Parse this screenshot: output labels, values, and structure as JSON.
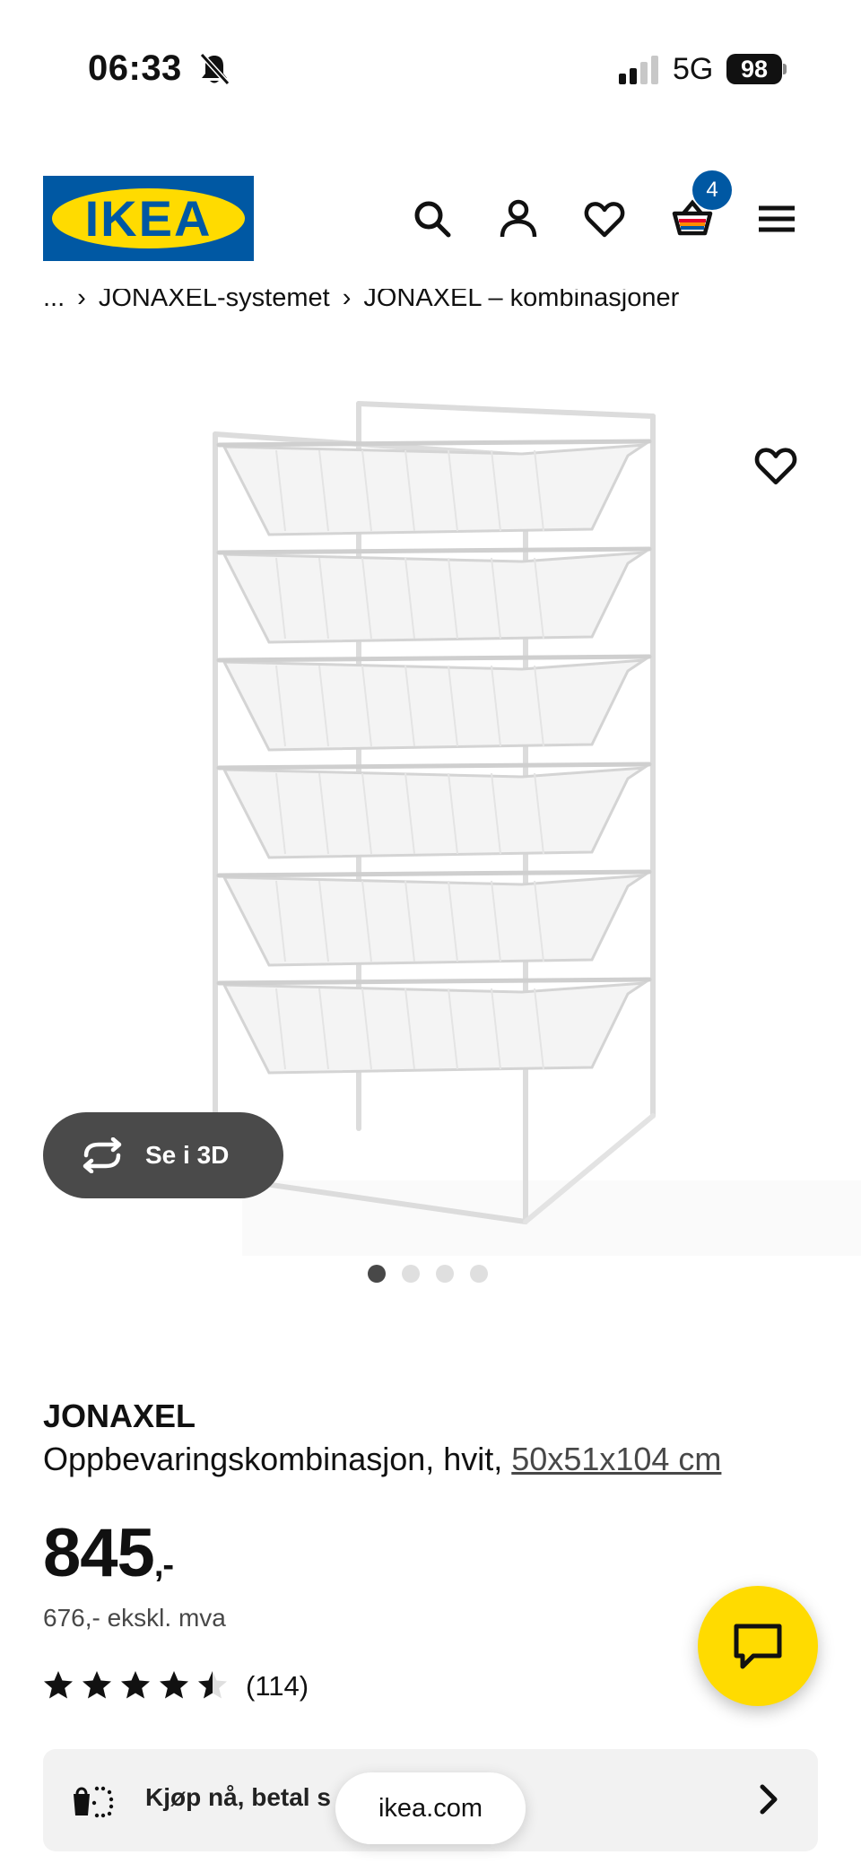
{
  "status_bar": {
    "time": "06:33",
    "network": "5G",
    "battery": "98"
  },
  "header": {
    "logo_text": "IKEA",
    "cart_count": "4"
  },
  "breadcrumb": {
    "items": [
      "...",
      "JONAXEL-systemet",
      "JONAXEL – kombinasjoner"
    ]
  },
  "gallery": {
    "view_3d_label": "Se i 3D",
    "image_count": 4,
    "active_index": 0
  },
  "product": {
    "name": "JONAXEL",
    "description": "Oppbevaringskombinasjon, hvit, ",
    "size": "50x51x104 cm",
    "price": "845",
    "price_suffix": ",-",
    "price_ex_vat": "676,- ekskl. mva",
    "rating_value": 4.5,
    "review_count": "(114)"
  },
  "pay_later": {
    "label": "Kjøp nå, betal s"
  },
  "browser": {
    "url": "ikea.com"
  },
  "colors": {
    "brand_blue": "#0058a3",
    "brand_yellow": "#ffdb00",
    "dark_button": "#4a4a4a"
  }
}
